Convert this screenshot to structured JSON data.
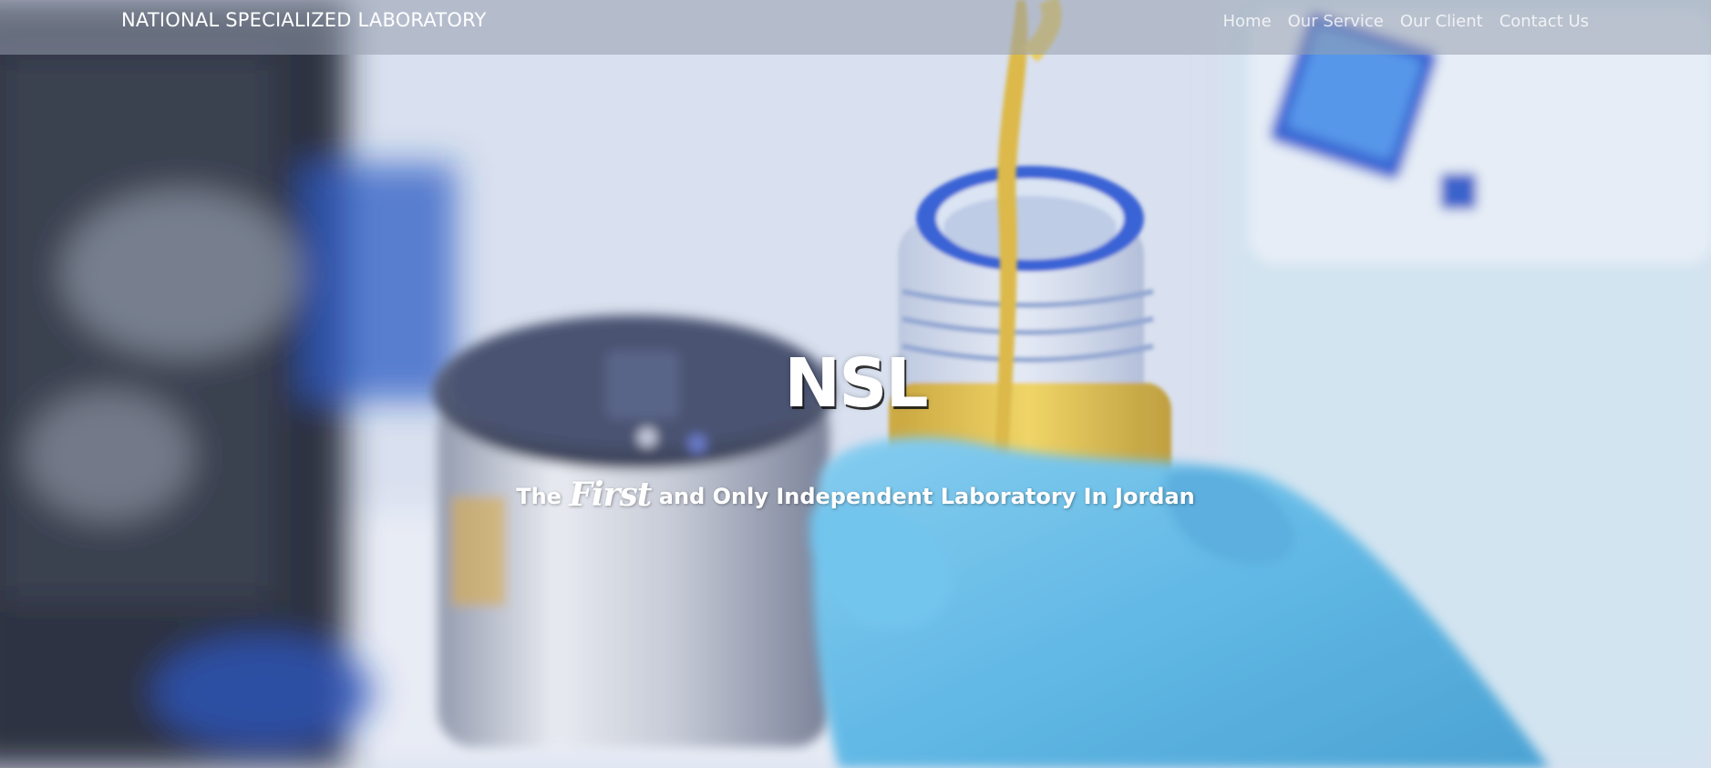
{
  "header": {
    "brand": "NATIONAL SPECIALIZED LABORATORY",
    "nav": [
      {
        "label": "Home"
      },
      {
        "label": "Our Service"
      },
      {
        "label": "Our Client"
      },
      {
        "label": "Contact Us"
      }
    ]
  },
  "hero": {
    "title": "NSL",
    "tagline_before": "The",
    "tagline_emphasis": "First",
    "tagline_after": "and Only Independent Laboratory In Jordan"
  },
  "colors": {
    "nav_background": "#969eaf",
    "text": "#ffffff",
    "glove": "#5bb9e6",
    "liquid": "#d8b12c"
  }
}
